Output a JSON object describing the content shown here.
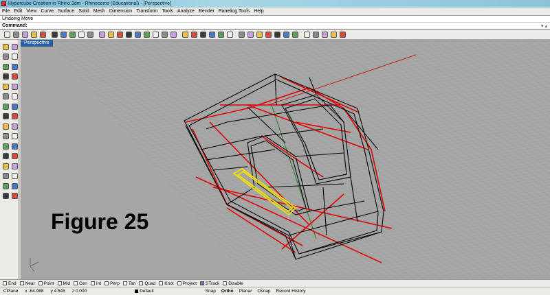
{
  "window": {
    "title": "Hypercube Creation in Rhino.3dm - Rhinoceros (Educational) - [Perspective]"
  },
  "menu": [
    "File",
    "Edit",
    "View",
    "Curve",
    "Surface",
    "Solid",
    "Mesh",
    "Dimension",
    "Transform",
    "Tools",
    "Analyze",
    "Render",
    "Paneling Tools",
    "Help"
  ],
  "command": {
    "history": "Undoing Move",
    "prompt": "Command:",
    "value": ""
  },
  "viewport": {
    "label": "Perspective"
  },
  "figure_caption": "Figure 25",
  "osnaps": [
    {
      "label": "End",
      "checked": false
    },
    {
      "label": "Near",
      "checked": false
    },
    {
      "label": "Point",
      "checked": false
    },
    {
      "label": "Mid",
      "checked": false
    },
    {
      "label": "Cen",
      "checked": false
    },
    {
      "label": "Int",
      "checked": false
    },
    {
      "label": "Perp",
      "checked": false
    },
    {
      "label": "Tan",
      "checked": false
    },
    {
      "label": "Quad",
      "checked": false
    },
    {
      "label": "Knot",
      "checked": false
    },
    {
      "label": "Project",
      "checked": false
    },
    {
      "label": "STrack",
      "checked": true
    },
    {
      "label": "Disable",
      "checked": false
    }
  ],
  "status": {
    "cplane": "CPlane",
    "x": "x -64.988",
    "y": "y 4.546",
    "z": "z 0.000",
    "layer": "Default",
    "toggles": [
      "Snap",
      "Ortho",
      "Planar",
      "Osnap",
      "Record History"
    ]
  },
  "colors": {
    "viewport_bg": "#a6a6a6",
    "accent": "#2d5fa0",
    "wire_red": "#e00000",
    "wire_yellow": "#f0e000"
  },
  "toolbar_icons": [
    "new-icon",
    "open-icon",
    "save-icon",
    "print-icon",
    "import-icon",
    "cut-icon",
    "copy-icon",
    "paste-icon",
    "undo-icon",
    "redo-icon",
    "pan-icon",
    "rotate-view-icon",
    "zoom-icon",
    "zoom-window-icon",
    "zoom-extents-icon",
    "zoom-selected-icon",
    "four-viewports-icon",
    "grid-icon",
    "cplane-icon",
    "select-icon",
    "hide-icon",
    "lock-icon",
    "layer-icon",
    "properties-icon",
    "bulb-icon",
    "render-icon",
    "material-icon",
    "sphere-render-icon",
    "globe-icon",
    "toolbox-icon",
    "wrench-icon",
    "arrange-icon",
    "explode-icon",
    "move-icon",
    "scale-icon",
    "orient-icon",
    "transform-icon"
  ],
  "left_icons": [
    "pointer-icon",
    "point-icon",
    "polyline-icon",
    "curve-icon",
    "circle-icon",
    "arc-icon",
    "ellipse-icon",
    "rectangle-icon",
    "polygon-icon",
    "freeform-icon",
    "fillet-icon",
    "offset-icon",
    "surface-icon",
    "loft-icon",
    "box-icon",
    "sphere-icon",
    "extrude-icon",
    "revolve-icon",
    "boolean-icon",
    "shell-icon",
    "mesh-icon",
    "split-icon",
    "trim-icon",
    "join-icon",
    "move-tool-icon",
    "array-icon",
    "dimension-icon",
    "text-icon",
    "analyze-icon",
    "render-tool-icon",
    "layer-tool-icon",
    "dot-icon"
  ]
}
